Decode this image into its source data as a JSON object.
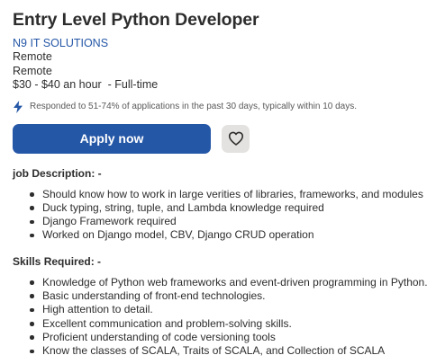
{
  "job": {
    "title": "Entry Level Python Developer",
    "company": "N9 IT SOLUTIONS",
    "location": "Remote",
    "work_mode": "Remote",
    "pay": "$30 - $40 an hour",
    "job_type": "  - Full-time"
  },
  "responded": {
    "icon": "lightning-bolt-icon",
    "text": "Responded to 51-74% of applications in the past 30 days, typically within 10 days."
  },
  "actions": {
    "apply_label": "Apply now",
    "save_icon": "heart-icon"
  },
  "colors": {
    "accent": "#2557a7",
    "save_button_bg": "#e4e2e0",
    "text": "#2d2d2d"
  },
  "description": {
    "heading": "job Description: -",
    "items": [
      "Should know how to work in large verities of libraries, frameworks, and modules",
      "Duck typing, string, tuple, and Lambda knowledge required",
      "Django Framework required",
      "Worked on Django model, CBV, Django CRUD operation"
    ]
  },
  "skills": {
    "heading": "Skills Required: -",
    "items": [
      "Knowledge of Python web frameworks and event-driven programming in Python.",
      "Basic understanding of front-end technologies.",
      "High attention to detail.",
      "Excellent communication and problem-solving skills.",
      "Proficient understanding of code versioning tools",
      "Know the classes of SCALA, Traits of SCALA, and Collection of SCALA"
    ]
  }
}
